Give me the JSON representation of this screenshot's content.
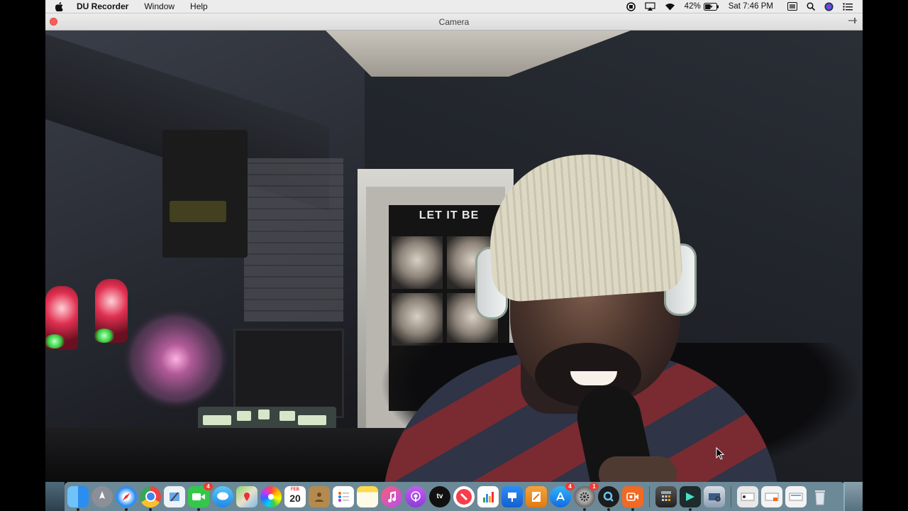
{
  "menubar": {
    "app_name": "DU Recorder",
    "menus": [
      "Window",
      "Help"
    ],
    "battery": "42%",
    "clock": "Sat 7:46 PM"
  },
  "window": {
    "title": "Camera"
  },
  "camera": {
    "poster_title": "LET IT BE"
  },
  "dock": {
    "badges": {
      "facetime": "4",
      "app_store": "4",
      "system_preferences": "1"
    },
    "calendar_month": "FEB",
    "calendar_day": "20"
  },
  "colors": {
    "menubar_bg": "#ececec",
    "close_button": "#fc5d57",
    "dock_bg": "#96bed2"
  }
}
